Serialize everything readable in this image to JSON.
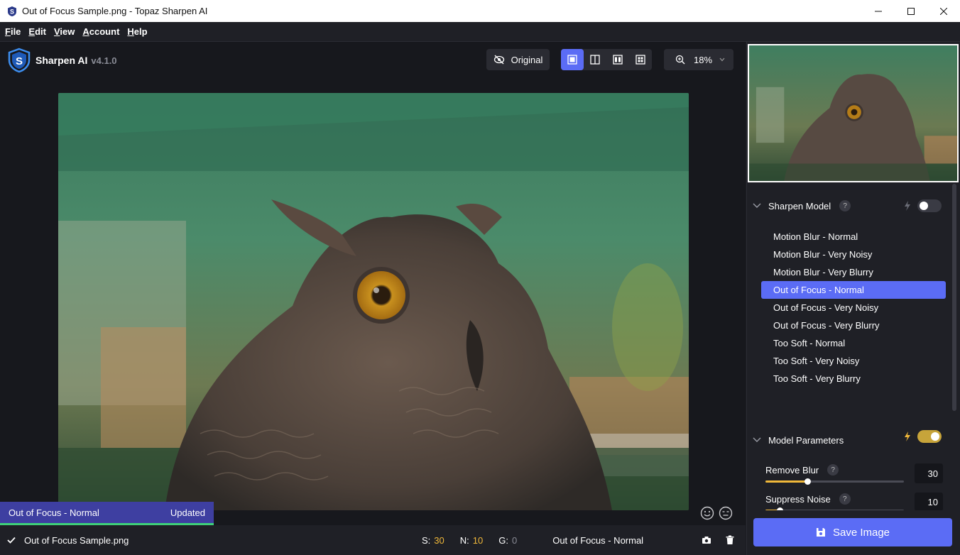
{
  "window": {
    "title": "Out of Focus Sample.png - Topaz Sharpen AI"
  },
  "menu": {
    "items": [
      {
        "label": "File",
        "key": "F",
        "rest": "ile"
      },
      {
        "label": "Edit",
        "key": "E",
        "rest": "dit"
      },
      {
        "label": "View",
        "key": "V",
        "rest": "iew"
      },
      {
        "label": "Account",
        "key": "A",
        "rest": "ccount"
      },
      {
        "label": "Help",
        "key": "H",
        "rest": "elp"
      }
    ]
  },
  "header": {
    "app_name": "Sharpen AI",
    "version": "v4.1.0",
    "original_label": "Original",
    "zoom": "18%"
  },
  "icons": {
    "logo": "topaz-s-logo-icon",
    "original": "eye-off-icon",
    "views": [
      "single-view-icon",
      "split-view-icon",
      "side-by-side-icon",
      "quad-view-icon"
    ],
    "zoom": "zoom-in-icon",
    "save": "floppy-disk-icon"
  },
  "preview": {
    "status_model": "Out of Focus - Normal",
    "status_state": "Updated"
  },
  "bottombar": {
    "filename": "Out of Focus Sample.png",
    "s_label": "S:",
    "s_value": "30",
    "n_label": "N:",
    "n_value": "10",
    "g_label": "G:",
    "g_value": "0",
    "model": "Out of Focus - Normal"
  },
  "sidebar": {
    "sharpen_model": {
      "title": "Sharpen Model",
      "help": "?",
      "auto_enabled": false,
      "models": [
        "Motion Blur - Normal",
        "Motion Blur - Very Noisy",
        "Motion Blur - Very Blurry",
        "Out of Focus - Normal",
        "Out of Focus - Very Noisy",
        "Out of Focus - Very Blurry",
        "Too Soft - Normal",
        "Too Soft - Very Noisy",
        "Too Soft - Very Blurry"
      ],
      "selected_index": 3
    },
    "model_parameters": {
      "title": "Model Parameters",
      "auto_enabled": true,
      "remove_blur": {
        "label": "Remove Blur",
        "help": "?",
        "value": "30",
        "fraction": 0.3
      },
      "suppress_noise": {
        "label": "Suppress Noise",
        "help": "?",
        "value": "10",
        "fraction": 0.1
      }
    },
    "save_label": "Save Image"
  },
  "colors": {
    "accent": "#5b6cf5",
    "highlight": "#f0b83a",
    "success": "#3ed07a"
  }
}
